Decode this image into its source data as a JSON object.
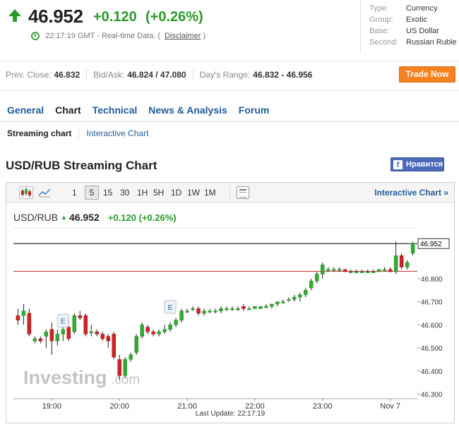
{
  "quote": {
    "price": "46.952",
    "change": "+0.120",
    "change_pct": "(+0.26%)",
    "time": "22:17:19 GMT",
    "data_note": "Real-time Data.",
    "disclaimer_open": "(",
    "disclaimer": "Disclaimer",
    "disclaimer_close": ")"
  },
  "info": [
    {
      "key": "Type:",
      "value": "Currency"
    },
    {
      "key": "Group:",
      "value": "Exotic"
    },
    {
      "key": "Base:",
      "value": "US Dollar"
    },
    {
      "key": "Second:",
      "value": "Russian Ruble"
    }
  ],
  "stats": {
    "prev_close_label": "Prev. Close:",
    "prev_close": "46.832",
    "bid_ask_label": "Bid/Ask:",
    "bid_ask": "46.824 / 47.080",
    "days_range_label": "Day's Range:",
    "days_range": "46.832 - 46.956"
  },
  "trade_button": "Trade Now",
  "tabs": [
    "General",
    "Chart",
    "Technical",
    "News & Analysis",
    "Forum"
  ],
  "subtabs": [
    "Streaming chart",
    "Interactive Chart"
  ],
  "chart_title": "USD/RUB Streaming Chart",
  "fb_like": "Нравится",
  "toolbar": {
    "timeframes": [
      "1",
      "5",
      "15",
      "30",
      "1H",
      "5H",
      "1D",
      "1W",
      "1M"
    ],
    "selected": "5",
    "interactive_link": "Interactive Chart »"
  },
  "legend": {
    "symbol": "USD/RUB",
    "price": "46.952",
    "change": "+0.120 (+0.26%)"
  },
  "footer": "Last Update: 22:17:19",
  "watermark": {
    "main": "Investing",
    "suffix": ".com"
  },
  "colors": {
    "up": "#33aa33",
    "down": "#cc2222",
    "prev_close_line": "#cc3333",
    "price_line": "#000000"
  },
  "chart_data": {
    "type": "candlestick",
    "title": "USD/RUB",
    "x_tick_labels": [
      "19:00",
      "20:00",
      "21:00",
      "22:00",
      "23:00",
      "Nov 7"
    ],
    "x_tick_times": [
      "18:45",
      "19:45",
      "20:45",
      "21:45",
      "22:45",
      "23:45"
    ],
    "y_ticks": [
      46.3,
      46.4,
      46.5,
      46.6,
      46.7,
      46.8
    ],
    "y_tick_labels": [
      "46.300",
      "46.400",
      "46.500",
      "46.600",
      "46.700",
      "46.800"
    ],
    "ylim": [
      46.28,
      47.02
    ],
    "last_price": 46.952,
    "last_price_label": "46.952",
    "prev_close": 46.832,
    "event_markers": [
      {
        "time": "18:55",
        "label": "E",
        "price": 46.59
      },
      {
        "time": "20:30",
        "label": "E",
        "price": 46.65
      }
    ],
    "candles": [
      {
        "t": "18:15",
        "o": 46.64,
        "h": 46.67,
        "l": 46.6,
        "c": 46.62
      },
      {
        "t": "18:20",
        "o": 46.64,
        "h": 46.69,
        "l": 46.6,
        "c": 46.66
      },
      {
        "t": "18:25",
        "o": 46.65,
        "h": 46.67,
        "l": 46.55,
        "c": 46.56
      },
      {
        "t": "18:30",
        "o": 46.53,
        "h": 46.55,
        "l": 46.52,
        "c": 46.54
      },
      {
        "t": "18:35",
        "o": 46.54,
        "h": 46.55,
        "l": 46.52,
        "c": 46.53
      },
      {
        "t": "18:40",
        "o": 46.55,
        "h": 46.58,
        "l": 46.5,
        "c": 46.57
      },
      {
        "t": "18:45",
        "o": 46.58,
        "h": 46.61,
        "l": 46.47,
        "c": 46.53
      },
      {
        "t": "18:50",
        "o": 46.53,
        "h": 46.58,
        "l": 46.51,
        "c": 46.56
      },
      {
        "t": "18:55",
        "o": 46.56,
        "h": 46.59,
        "l": 46.53,
        "c": 46.58
      },
      {
        "t": "19:00",
        "o": 46.59,
        "h": 46.63,
        "l": 46.53,
        "c": 46.54
      },
      {
        "t": "19:05",
        "o": 46.57,
        "h": 46.65,
        "l": 46.56,
        "c": 46.64
      },
      {
        "t": "19:10",
        "o": 46.64,
        "h": 46.66,
        "l": 46.62,
        "c": 46.63
      },
      {
        "t": "19:15",
        "o": 46.64,
        "h": 46.65,
        "l": 46.55,
        "c": 46.56
      },
      {
        "t": "19:20",
        "o": 46.57,
        "h": 46.6,
        "l": 46.55,
        "c": 46.57
      },
      {
        "t": "19:25",
        "o": 46.57,
        "h": 46.58,
        "l": 46.55,
        "c": 46.56
      },
      {
        "t": "19:30",
        "o": 46.56,
        "h": 46.57,
        "l": 46.53,
        "c": 46.54
      },
      {
        "t": "19:35",
        "o": 46.55,
        "h": 46.56,
        "l": 46.5,
        "c": 46.53
      },
      {
        "t": "19:40",
        "o": 46.56,
        "h": 46.57,
        "l": 46.45,
        "c": 46.46
      },
      {
        "t": "19:45",
        "o": 46.45,
        "h": 46.47,
        "l": 46.36,
        "c": 46.38
      },
      {
        "t": "19:50",
        "o": 46.38,
        "h": 46.46,
        "l": 46.37,
        "c": 46.45
      },
      {
        "t": "19:55",
        "o": 46.45,
        "h": 46.48,
        "l": 46.44,
        "c": 46.47
      },
      {
        "t": "20:00",
        "o": 46.48,
        "h": 46.56,
        "l": 46.47,
        "c": 46.55
      },
      {
        "t": "20:05",
        "o": 46.55,
        "h": 46.61,
        "l": 46.54,
        "c": 46.6
      },
      {
        "t": "20:10",
        "o": 46.59,
        "h": 46.6,
        "l": 46.56,
        "c": 46.57
      },
      {
        "t": "20:15",
        "o": 46.57,
        "h": 46.58,
        "l": 46.55,
        "c": 46.56
      },
      {
        "t": "20:20",
        "o": 46.56,
        "h": 46.58,
        "l": 46.55,
        "c": 46.57
      },
      {
        "t": "20:25",
        "o": 46.57,
        "h": 46.6,
        "l": 46.56,
        "c": 46.58
      },
      {
        "t": "20:30",
        "o": 46.58,
        "h": 46.61,
        "l": 46.57,
        "c": 46.6
      },
      {
        "t": "20:35",
        "o": 46.6,
        "h": 46.63,
        "l": 46.59,
        "c": 46.62
      },
      {
        "t": "20:40",
        "o": 46.62,
        "h": 46.67,
        "l": 46.61,
        "c": 46.66
      },
      {
        "t": "20:45",
        "o": 46.66,
        "h": 46.67,
        "l": 46.65,
        "c": 46.66
      },
      {
        "t": "20:50",
        "o": 46.67,
        "h": 46.68,
        "l": 46.66,
        "c": 46.67
      },
      {
        "t": "20:55",
        "o": 46.67,
        "h": 46.68,
        "l": 46.64,
        "c": 46.65
      },
      {
        "t": "21:00",
        "o": 46.65,
        "h": 46.67,
        "l": 46.64,
        "c": 46.66
      },
      {
        "t": "21:05",
        "o": 46.66,
        "h": 46.67,
        "l": 46.65,
        "c": 46.66
      },
      {
        "t": "21:10",
        "o": 46.66,
        "h": 46.67,
        "l": 46.65,
        "c": 46.66
      },
      {
        "t": "21:15",
        "o": 46.66,
        "h": 46.68,
        "l": 46.65,
        "c": 46.67
      },
      {
        "t": "21:20",
        "o": 46.67,
        "h": 46.68,
        "l": 46.66,
        "c": 46.67
      },
      {
        "t": "21:25",
        "o": 46.67,
        "h": 46.68,
        "l": 46.66,
        "c": 46.67
      },
      {
        "t": "21:30",
        "o": 46.67,
        "h": 46.68,
        "l": 46.66,
        "c": 46.67
      },
      {
        "t": "21:35",
        "o": 46.68,
        "h": 46.69,
        "l": 46.66,
        "c": 46.67
      },
      {
        "t": "21:40",
        "o": 46.67,
        "h": 46.68,
        "l": 46.67,
        "c": 46.67
      },
      {
        "t": "21:45",
        "o": 46.67,
        "h": 46.68,
        "l": 46.67,
        "c": 46.68
      },
      {
        "t": "21:50",
        "o": 46.67,
        "h": 46.68,
        "l": 46.67,
        "c": 46.68
      },
      {
        "t": "21:55",
        "o": 46.68,
        "h": 46.69,
        "l": 46.67,
        "c": 46.68
      },
      {
        "t": "22:00",
        "o": 46.68,
        "h": 46.69,
        "l": 46.67,
        "c": 46.69
      },
      {
        "t": "22:05",
        "o": 46.69,
        "h": 46.7,
        "l": 46.68,
        "c": 46.7
      },
      {
        "t": "22:10",
        "o": 46.7,
        "h": 46.71,
        "l": 46.69,
        "c": 46.7
      },
      {
        "t": "22:15",
        "o": 46.71,
        "h": 46.72,
        "l": 46.7,
        "c": 46.71
      },
      {
        "t": "22:20",
        "o": 46.71,
        "h": 46.73,
        "l": 46.7,
        "c": 46.72
      },
      {
        "t": "22:25",
        "o": 46.72,
        "h": 46.74,
        "l": 46.7,
        "c": 46.73
      },
      {
        "t": "22:30",
        "o": 46.73,
        "h": 46.76,
        "l": 46.72,
        "c": 46.75
      },
      {
        "t": "22:35",
        "o": 46.76,
        "h": 46.8,
        "l": 46.75,
        "c": 46.79
      },
      {
        "t": "22:40",
        "o": 46.79,
        "h": 46.83,
        "l": 46.78,
        "c": 46.82
      },
      {
        "t": "22:45",
        "o": 46.82,
        "h": 46.87,
        "l": 46.8,
        "c": 46.86
      },
      {
        "t": "22:50",
        "o": 46.84,
        "h": 46.85,
        "l": 46.83,
        "c": 46.84
      },
      {
        "t": "22:55",
        "o": 46.84,
        "h": 46.85,
        "l": 46.83,
        "c": 46.84
      },
      {
        "t": "23:00",
        "o": 46.84,
        "h": 46.85,
        "l": 46.83,
        "c": 46.84
      },
      {
        "t": "23:05",
        "o": 46.84,
        "h": 46.84,
        "l": 46.83,
        "c": 46.83
      },
      {
        "t": "23:10",
        "o": 46.83,
        "h": 46.84,
        "l": 46.83,
        "c": 46.83
      },
      {
        "t": "23:15",
        "o": 46.83,
        "h": 46.84,
        "l": 46.83,
        "c": 46.83
      },
      {
        "t": "23:20",
        "o": 46.83,
        "h": 46.84,
        "l": 46.83,
        "c": 46.83
      },
      {
        "t": "23:25",
        "o": 46.83,
        "h": 46.84,
        "l": 46.83,
        "c": 46.83
      },
      {
        "t": "23:30",
        "o": 46.83,
        "h": 46.84,
        "l": 46.83,
        "c": 46.83
      },
      {
        "t": "23:35",
        "o": 46.83,
        "h": 46.84,
        "l": 46.83,
        "c": 46.84
      },
      {
        "t": "23:40",
        "o": 46.84,
        "h": 46.85,
        "l": 46.83,
        "c": 46.84
      },
      {
        "t": "23:45",
        "o": 46.84,
        "h": 46.85,
        "l": 46.83,
        "c": 46.83
      },
      {
        "t": "23:50",
        "o": 46.83,
        "h": 46.96,
        "l": 46.82,
        "c": 46.9
      },
      {
        "t": "23:55",
        "o": 46.9,
        "h": 46.91,
        "l": 46.84,
        "c": 46.85
      },
      {
        "t": "00:00",
        "o": 46.85,
        "h": 46.88,
        "l": 46.84,
        "c": 46.87
      },
      {
        "t": "00:05",
        "o": 46.91,
        "h": 46.96,
        "l": 46.9,
        "c": 46.952
      }
    ]
  }
}
